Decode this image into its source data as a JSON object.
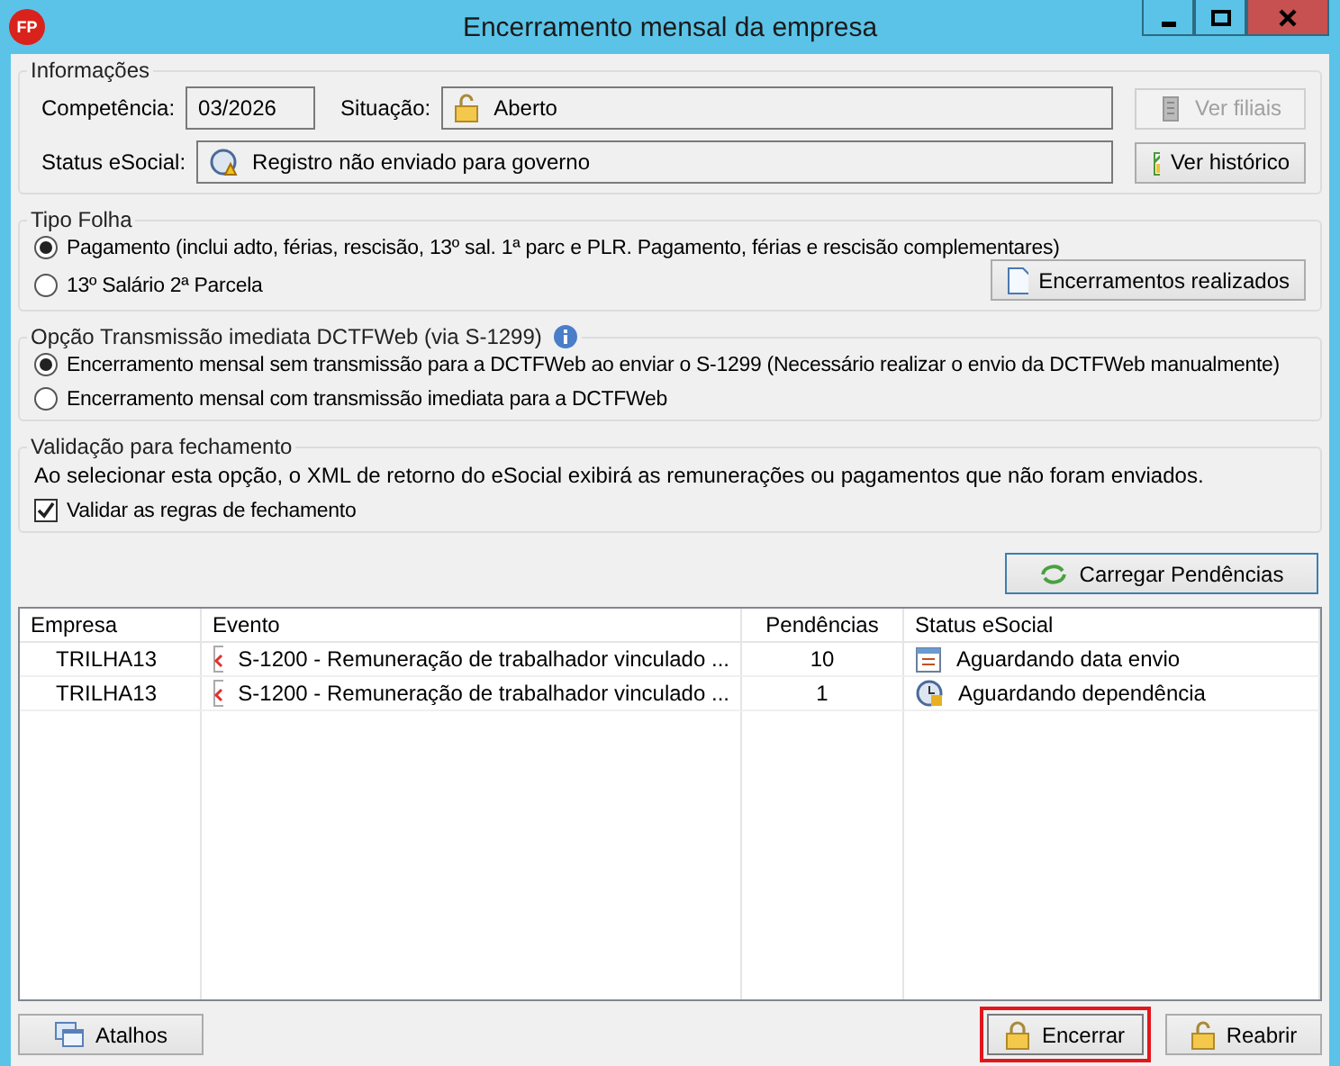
{
  "window": {
    "title": "Encerramento mensal da empresa",
    "app_badge": "FP"
  },
  "informacoes": {
    "title": "Informações",
    "competencia_label": "Competência:",
    "competencia": "03/2026",
    "situacao_label": "Situação:",
    "situacao": "Aberto",
    "status_label": "Status eSocial:",
    "status": "Registro não enviado para governo",
    "buttons": [
      {
        "label": "Ver filiais",
        "kind": "building",
        "disabled": true
      },
      {
        "label": "Ver histórico",
        "kind": "history",
        "disabled": false
      }
    ]
  },
  "tipo_folha": {
    "title": "Tipo Folha",
    "options": [
      {
        "label": "Pagamento (inclui adto, férias, rescisão, 13º sal. 1ª parc e PLR. Pagamento, férias e rescisão complementares)",
        "selected": true
      },
      {
        "label": "13º Salário 2ª Parcela",
        "selected": false
      }
    ],
    "button": "Encerramentos realizados"
  },
  "opcao_transmissao": {
    "title": "Opção Transmissão imediata DCTFWeb (via S-1299)",
    "options": [
      {
        "label": "Encerramento mensal sem transmissão para a DCTFWeb ao enviar o S-1299 (Necessário realizar o envio da DCTFWeb manualmente)",
        "selected": true
      },
      {
        "label": "Encerramento mensal com transmissão imediata para a DCTFWeb",
        "selected": false
      }
    ]
  },
  "validacao": {
    "title": "Validação para fechamento",
    "description": "Ao selecionar esta opção, o XML de retorno do eSocial exibirá as remunerações ou pagamentos que não foram enviados.",
    "checkbox": {
      "label": "Validar as regras de fechamento",
      "checked": true
    }
  },
  "carregar_button": "Carregar Pendências",
  "table": {
    "columns": [
      "Empresa",
      "Evento",
      "Pendências",
      "Status eSocial"
    ],
    "rows": [
      {
        "empresa": "TRILHA13",
        "evento": "S-1200 - Remuneração de trabalhador vinculado ...",
        "pendencias": "10",
        "status": "Aguardando data envio",
        "kind": "calendar"
      },
      {
        "empresa": "TRILHA13",
        "evento": "S-1200 - Remuneração de trabalhador vinculado ...",
        "pendencias": "1",
        "status": "Aguardando dependência",
        "kind": "clock"
      }
    ]
  },
  "footer": {
    "buttons": [
      {
        "label": "Atalhos",
        "kind": "windows",
        "highlighted": false
      },
      {
        "label": "Encerrar",
        "kind": "lock",
        "highlighted": true
      },
      {
        "label": "Reabrir",
        "kind": "unlock",
        "highlighted": false
      }
    ]
  }
}
